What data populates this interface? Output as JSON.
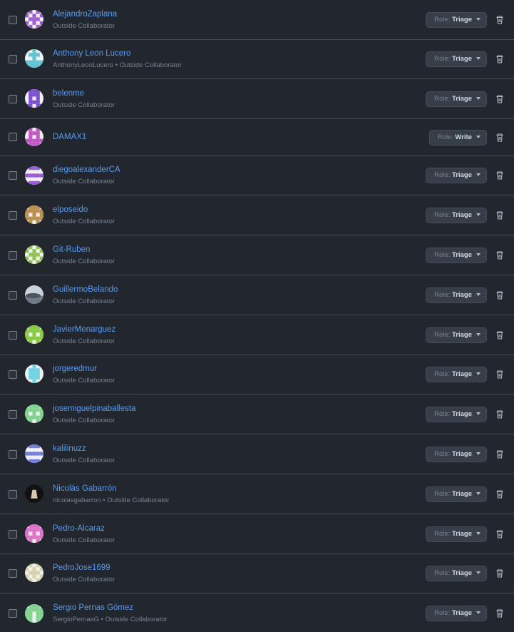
{
  "role_prefix": "Role:",
  "members": [
    {
      "name": "AlejandroZaplana",
      "sub": "Outside Collaborator",
      "role": "Triage",
      "avatar_color": "#a05fd1",
      "avatar_pattern": "cross"
    },
    {
      "name": "Anthony Leon Lucero",
      "sub": "AnthonyLeonLucero • Outside Collaborator",
      "role": "Triage",
      "avatar_color": "#5fc4d1",
      "avatar_pattern": "tower"
    },
    {
      "name": "belenme",
      "sub": "Outside Collaborator",
      "role": "Triage",
      "avatar_color": "#7a4fd6",
      "avatar_pattern": "tall"
    },
    {
      "name": "DAMAX1",
      "sub": "",
      "role": "Write",
      "avatar_color": "#c256c8",
      "avatar_pattern": "cup"
    },
    {
      "name": "diegoalexanderCA",
      "sub": "Outside Collaborator",
      "role": "Triage",
      "avatar_color": "#9b5ad9",
      "avatar_pattern": "bars"
    },
    {
      "name": "elposeido",
      "sub": "Outside Collaborator",
      "role": "Triage",
      "avatar_color": "#b8904c",
      "avatar_pattern": "face"
    },
    {
      "name": "Git-Ruben",
      "sub": "Outside Collaborator",
      "role": "Triage",
      "avatar_color": "#8fc44f",
      "avatar_pattern": "cross"
    },
    {
      "name": "GuillermoBelando",
      "sub": "Outside Collaborator",
      "role": "Triage",
      "avatar_color": "#6f7c88",
      "avatar_pattern": "photo"
    },
    {
      "name": "JavierMenarguez",
      "sub": "Outside Collaborator",
      "role": "Triage",
      "avatar_color": "#86cc3e",
      "avatar_pattern": "face"
    },
    {
      "name": "jorgeredmur",
      "sub": "Outside Collaborator",
      "role": "Triage",
      "avatar_color": "#6fd3e3",
      "avatar_pattern": "pillar"
    },
    {
      "name": "josemiguelpinaballesta",
      "sub": "Outside Collaborator",
      "role": "Triage",
      "avatar_color": "#7ed58a",
      "avatar_pattern": "face"
    },
    {
      "name": "kalilinuzz",
      "sub": "Outside Collaborator",
      "role": "Triage",
      "avatar_color": "#6f7fe0",
      "avatar_pattern": "bars"
    },
    {
      "name": "Nicolás Gabarrón",
      "sub": "nicolasgabarron • Outside Collaborator",
      "role": "Triage",
      "avatar_color": "#111111",
      "avatar_pattern": "dark"
    },
    {
      "name": "Pedro-Alcaraz",
      "sub": "Outside Collaborator",
      "role": "Triage",
      "avatar_color": "#e06fc9",
      "avatar_pattern": "face"
    },
    {
      "name": "PedroJose1699",
      "sub": "Outside Collaborator",
      "role": "Triage",
      "avatar_color": "#d8d3a6",
      "avatar_pattern": "cross"
    },
    {
      "name": "Sergio Pernas Gómez",
      "sub": "SergioPernasG • Outside Collaborator",
      "role": "Triage",
      "avatar_color": "#7fd48e",
      "avatar_pattern": "arch"
    }
  ]
}
